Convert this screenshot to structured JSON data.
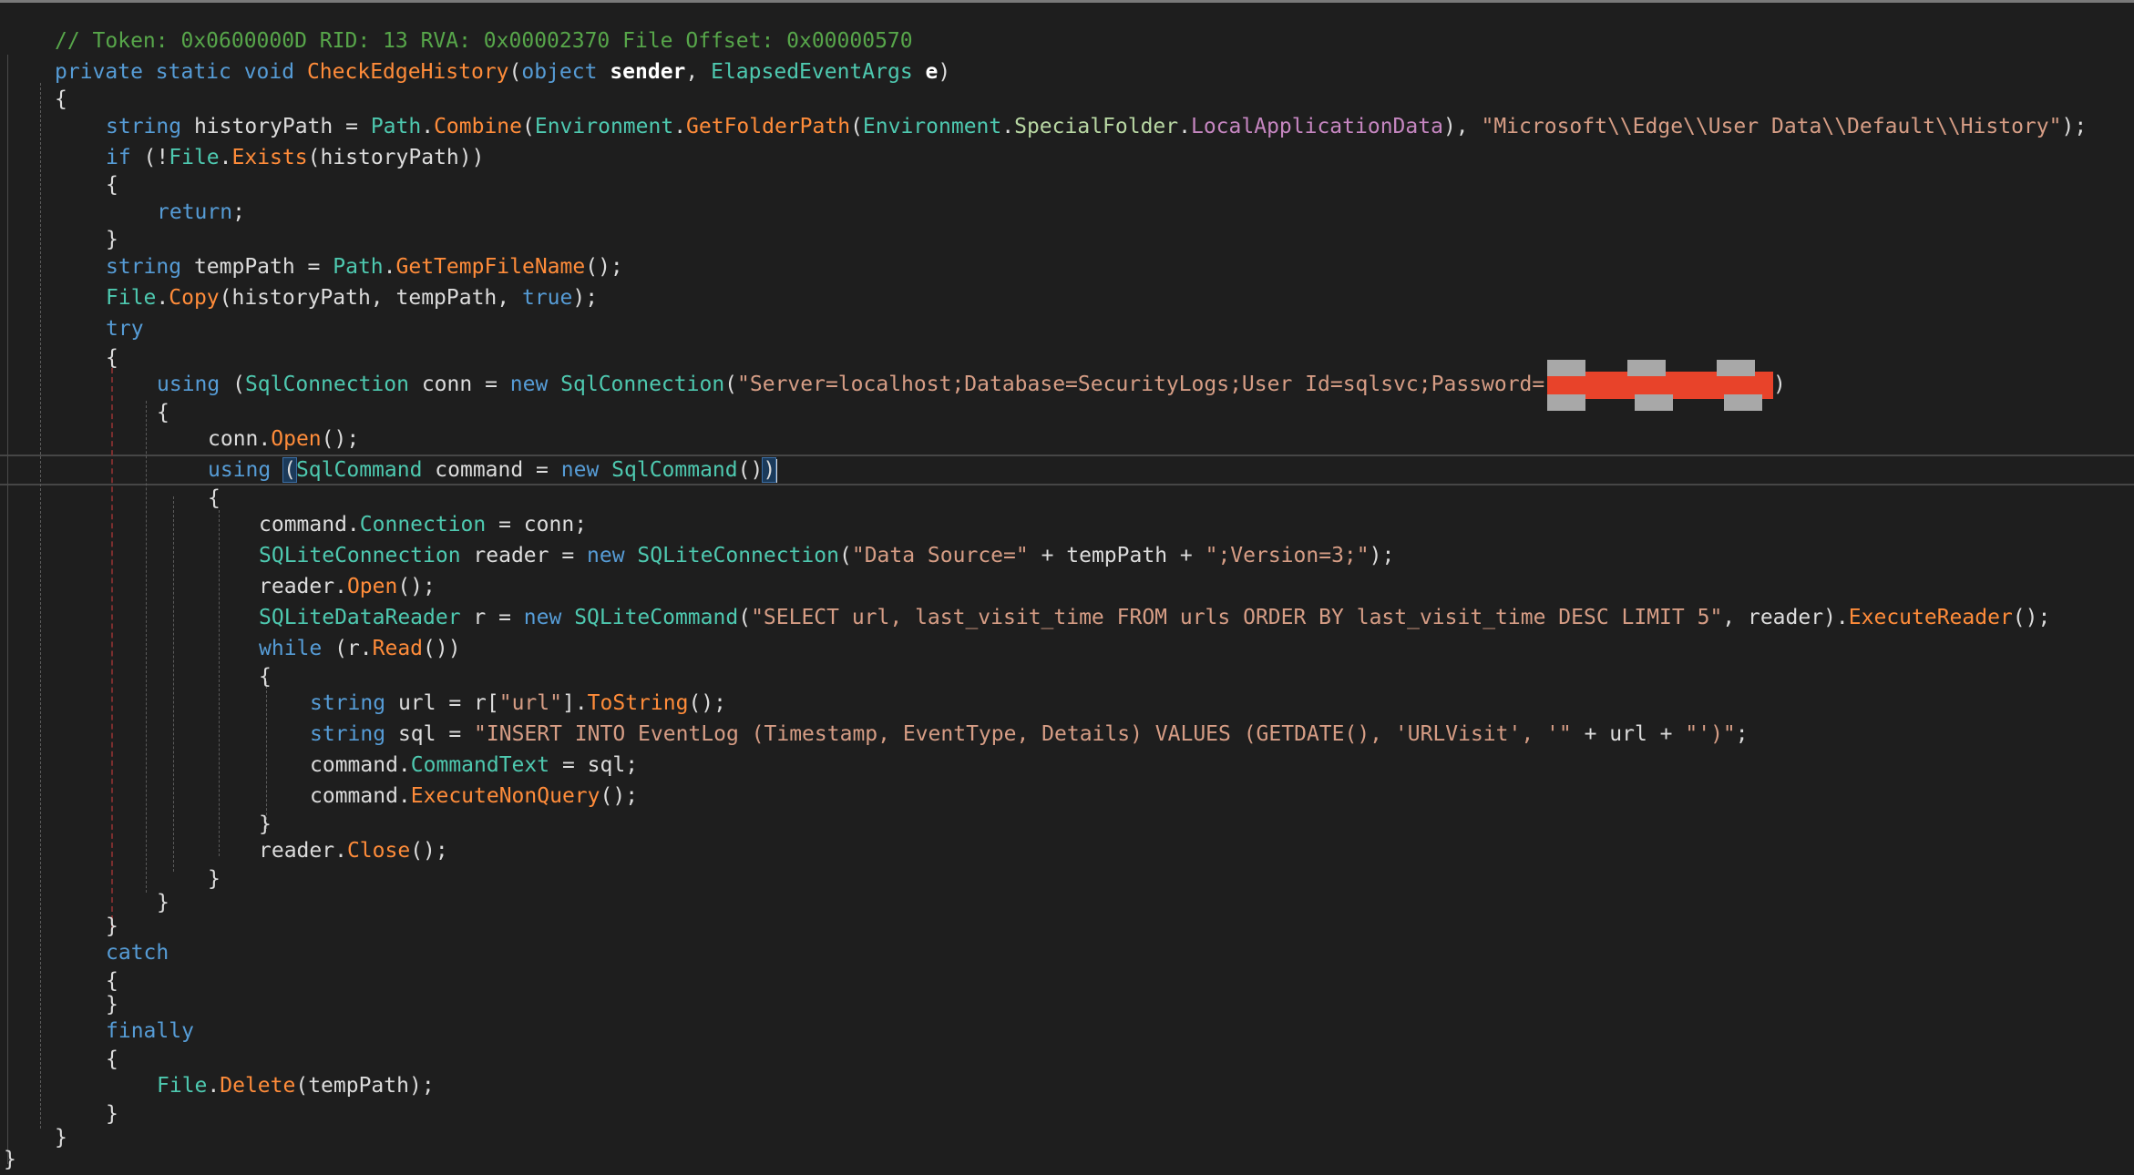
{
  "editor": {
    "lines": [
      "// Token: 0x0600000D RID: 13 RVA: 0x00002370 File Offset: 0x00000570",
      "private static void CheckEdgeHistory(object sender, ElapsedEventArgs e)",
      "{",
      "string historyPath = Path.Combine(Environment.GetFolderPath(Environment.SpecialFolder.LocalApplicationData), \"Microsoft\\\\Edge\\\\User Data\\\\Default\\\\History\");",
      "if (!File.Exists(historyPath))",
      "{",
      "return;",
      "}",
      "string tempPath = Path.GetTempFileName();",
      "File.Copy(historyPath, tempPath, true);",
      "try",
      "{",
      "using (SqlConnection conn = new SqlConnection(\"Server=localhost;Database=SecurityLogs;User Id=sqlsvc;Password=",
      "{",
      "conn.Open();",
      "using (SqlCommand command = new SqlCommand())",
      "{",
      "command.Connection = conn;",
      "SQLiteConnection reader = new SQLiteConnection(\"Data Source=\" + tempPath + \";Version=3;\");",
      "reader.Open();",
      "SQLiteDataReader r = new SQLiteCommand(\"SELECT url, last_visit_time FROM urls ORDER BY last_visit_time DESC LIMIT 5\", reader).ExecuteReader();",
      "while (r.Read())",
      "{",
      "string url = r[\"url\"].ToString();",
      "string sql = \"INSERT INTO EventLog (Timestamp, EventType, Details) VALUES (GETDATE(), 'URLVisit', '\" + url + \"')\";",
      "command.CommandText = sql;",
      "command.ExecuteNonQuery();",
      "}",
      "reader.Close();",
      "}",
      "}",
      "}",
      "catch",
      "{",
      "}",
      "finally",
      "{",
      "File.Delete(tempPath);",
      "}",
      "}",
      "}"
    ],
    "redaction_tail": ")",
    "colors": {
      "background": "#1e1e1e",
      "keyword": "#569cd6",
      "type": "#4ec9b0",
      "method": "#ff8c3a",
      "string": "#d69d85",
      "comment": "#57a64a",
      "enum_member": "#b8d7a3",
      "control": "#c586c0",
      "redaction": "#e8432a"
    }
  }
}
